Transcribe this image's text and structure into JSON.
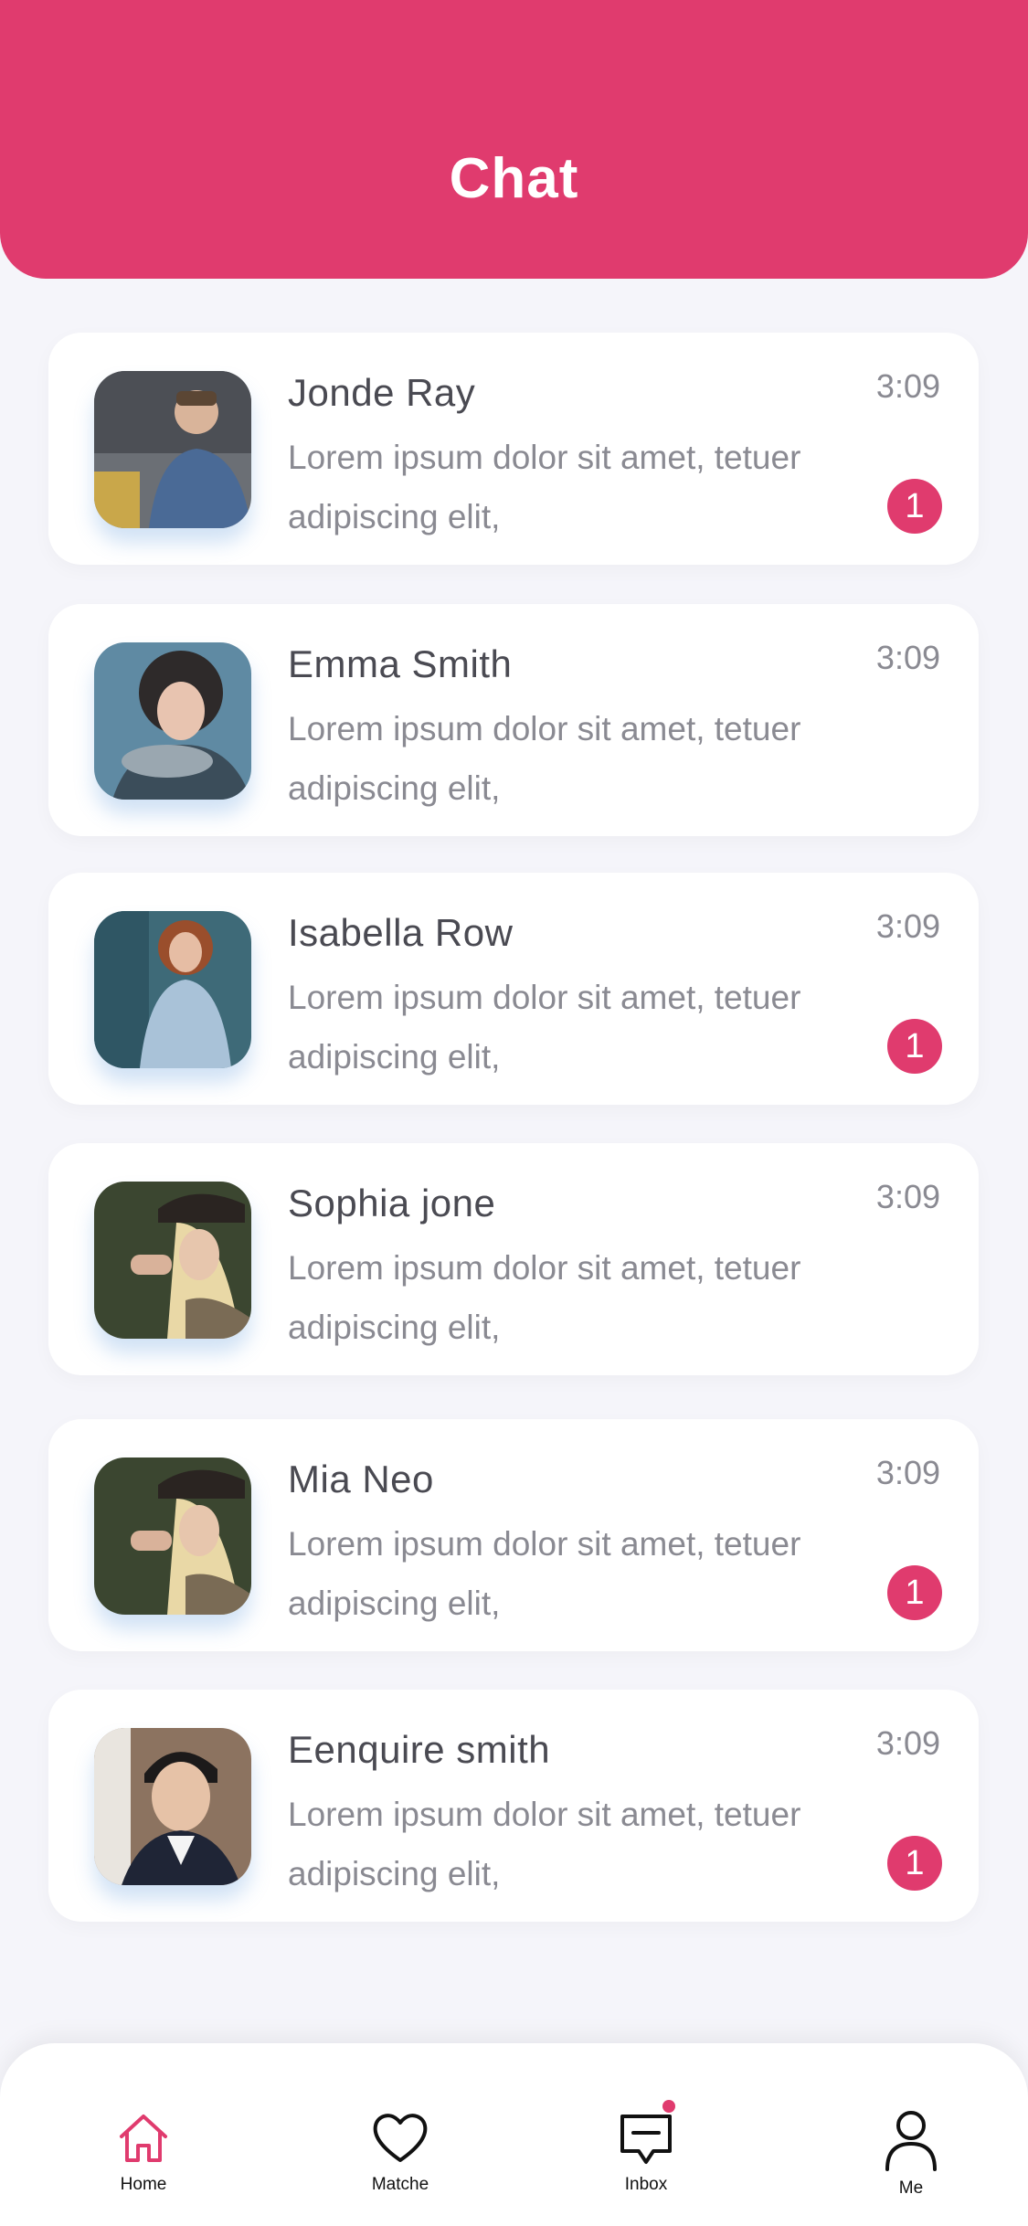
{
  "header": {
    "title": "Chat"
  },
  "chats": [
    {
      "name": "Jonde Ray",
      "message": "Lorem ipsum dolor sit amet, tetuer adipiscing elit,",
      "time": "3:09",
      "unread": "1"
    },
    {
      "name": "Emma Smith",
      "message": "Lorem ipsum dolor sit amet, tetuer adipiscing elit,",
      "time": "3:09",
      "unread": ""
    },
    {
      "name": "Isabella Row",
      "message": "Lorem ipsum dolor sit amet, tetuer adipiscing elit,",
      "time": "3:09",
      "unread": "1"
    },
    {
      "name": "Sophia jone",
      "message": "Lorem ipsum dolor sit amet, tetuer adipiscing elit,",
      "time": "3:09",
      "unread": ""
    },
    {
      "name": "Mia Neo",
      "message": "Lorem ipsum dolor sit amet, tetuer adipiscing elit,",
      "time": "3:09",
      "unread": "1"
    },
    {
      "name": "Eenquire smith",
      "message": "Lorem ipsum dolor sit amet, tetuer adipiscing elit,",
      "time": "3:09",
      "unread": "1"
    }
  ],
  "tabs": [
    {
      "label": "Home",
      "icon": "home-icon",
      "active": true
    },
    {
      "label": "Matche",
      "icon": "heart-icon",
      "active": false
    },
    {
      "label": "Inbox",
      "icon": "inbox-icon",
      "active": false
    },
    {
      "label": "Me",
      "icon": "person-icon",
      "active": false
    }
  ],
  "colors": {
    "accent": "#e03b6e",
    "background": "#f5f5fa",
    "text": "#4a4a52",
    "muted": "#8a8a92"
  }
}
